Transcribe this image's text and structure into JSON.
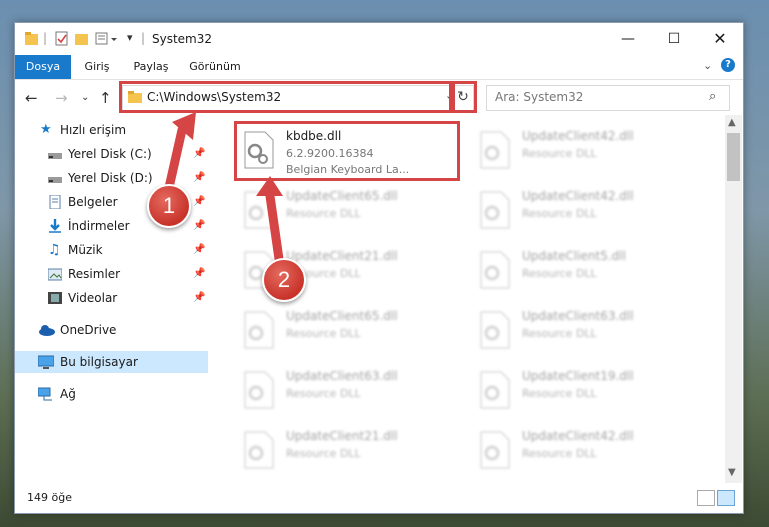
{
  "window": {
    "title": "System32"
  },
  "ribbon": {
    "tabs": [
      "Dosya",
      "Giriş",
      "Paylaş",
      "Görünüm"
    ]
  },
  "address": {
    "path": "C:\\Windows\\System32"
  },
  "search": {
    "placeholder": "Ara: System32"
  },
  "nav": {
    "items": [
      {
        "label": "Hızlı erişim",
        "icon": "star-icon"
      },
      {
        "label": "Yerel Disk (C:)",
        "icon": "drive-icon",
        "pinned": true
      },
      {
        "label": "Yerel Disk (D:)",
        "icon": "drive-icon",
        "pinned": true
      },
      {
        "label": "Belgeler",
        "icon": "documents-icon",
        "pinned": true
      },
      {
        "label": "İndirmeler",
        "icon": "download-icon",
        "pinned": true
      },
      {
        "label": "Müzik",
        "icon": "music-icon",
        "pinned": true
      },
      {
        "label": "Resimler",
        "icon": "pictures-icon",
        "pinned": true
      },
      {
        "label": "Videolar",
        "icon": "videos-icon",
        "pinned": true
      },
      {
        "label": "OneDrive",
        "icon": "cloud-icon"
      },
      {
        "label": "Bu bilgisayar",
        "icon": "computer-icon",
        "selected": true
      },
      {
        "label": "Ağ",
        "icon": "network-icon"
      }
    ]
  },
  "files": [
    {
      "name": "kbdbe.dll",
      "version": "6.2.9200.16384",
      "desc": "Belgian Keyboard La..."
    },
    {
      "name": "UpdateClient42.dll",
      "desc": "Resource DLL"
    },
    {
      "name": "UpdateClient65.dll",
      "desc": "Resource DLL"
    },
    {
      "name": "UpdateClient42.dll",
      "desc": "Resource DLL"
    },
    {
      "name": "UpdateClient21.dll",
      "desc": "Resource DLL"
    },
    {
      "name": "UpdateClient5.dll",
      "desc": "Resource DLL"
    },
    {
      "name": "UpdateClient65.dll",
      "desc": "Resource DLL"
    },
    {
      "name": "UpdateClient63.dll",
      "desc": "Resource DLL"
    },
    {
      "name": "UpdateClient63.dll",
      "desc": "Resource DLL"
    },
    {
      "name": "UpdateClient19.dll",
      "desc": "Resource DLL"
    },
    {
      "name": "UpdateClient21.dll",
      "desc": "Resource DLL"
    },
    {
      "name": "UpdateClient42.dll",
      "desc": "Resource DLL"
    }
  ],
  "status": {
    "count": "149 öğe"
  },
  "callouts": {
    "one": "1",
    "two": "2"
  },
  "colors": {
    "accent": "#1979ca",
    "highlight": "#d64545",
    "marker": "#c8332a"
  }
}
